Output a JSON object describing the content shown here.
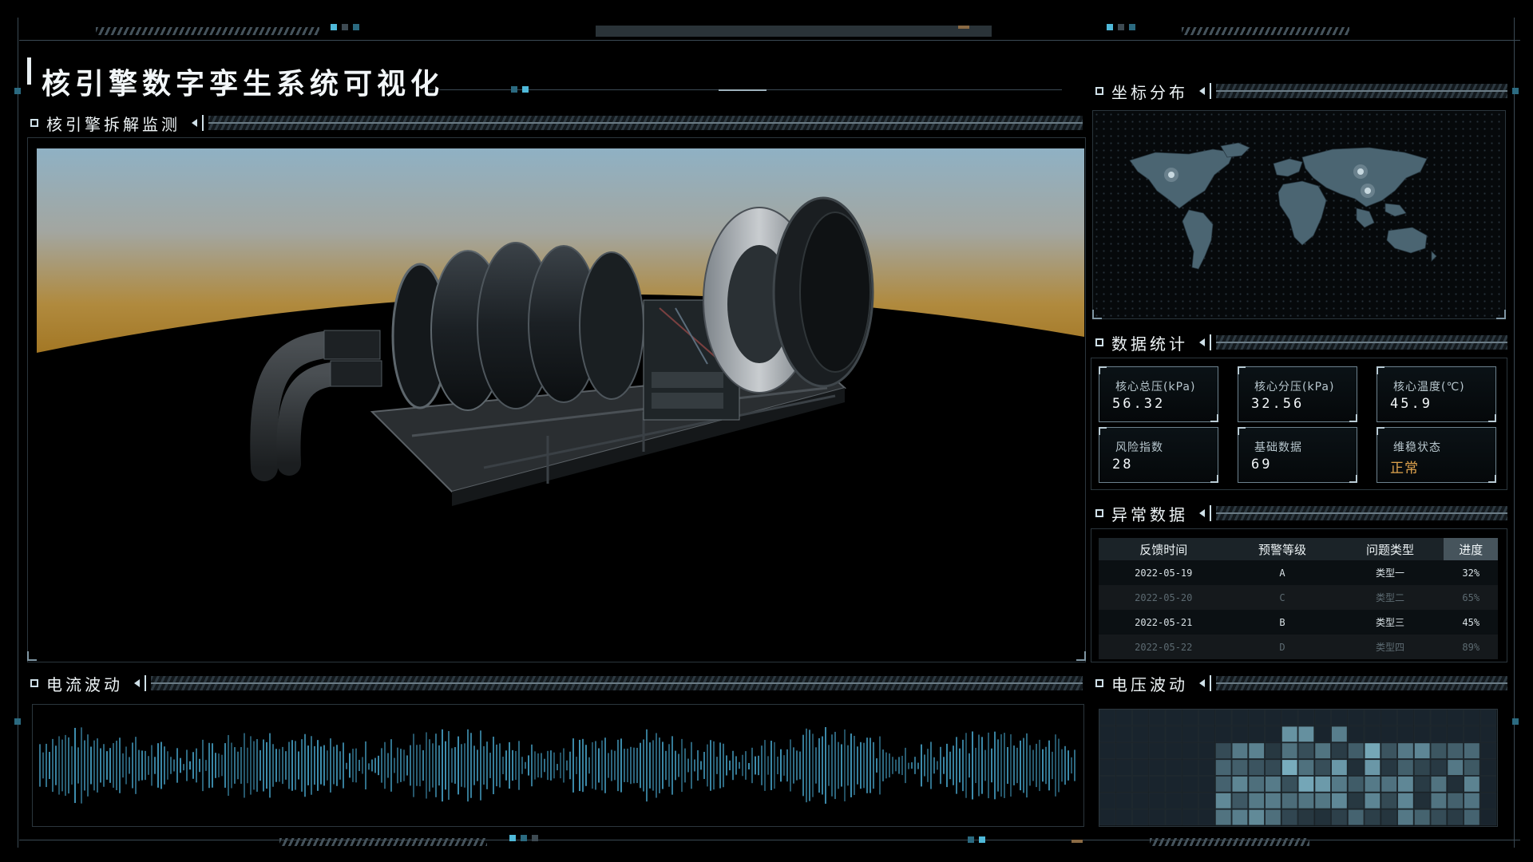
{
  "header": {
    "title": "核引擎数字孪生系统可视化"
  },
  "panels": {
    "engine": "核引擎拆解监测",
    "map": "坐标分布",
    "stats": "数据统计",
    "anomaly": "异常数据",
    "current": "电流波动",
    "voltage": "电压波动"
  },
  "stats": [
    {
      "label": "核心总压(kPa)",
      "value": "56.32"
    },
    {
      "label": "核心分压(kPa)",
      "value": "32.56"
    },
    {
      "label": "核心温度(℃)",
      "value": "45.9"
    },
    {
      "label": "风险指数",
      "value": "28"
    },
    {
      "label": "基础数据",
      "value": "69"
    },
    {
      "label": "维稳状态",
      "value": "正常"
    }
  ],
  "colors": {
    "accent": "#4fb9d9",
    "warning": "#e0a44e",
    "wave": "#3e8fb0",
    "map_land": "#4b6572"
  },
  "table": {
    "headers": [
      "反馈时间",
      "预警等级",
      "问题类型",
      "进度"
    ],
    "active_header": 3,
    "rows": [
      [
        "2022-05-19",
        "A",
        "类型一",
        "32%"
      ],
      [
        "2022-05-20",
        "C",
        "类型二",
        "65%"
      ],
      [
        "2022-05-21",
        "B",
        "类型三",
        "45%"
      ],
      [
        "2022-05-22",
        "D",
        "类型四",
        "89%"
      ]
    ]
  },
  "icons": {
    "panel_marker": "square-outline-icon",
    "collapse": "caret-left-icon",
    "map_point": "glow-dot-icon"
  }
}
